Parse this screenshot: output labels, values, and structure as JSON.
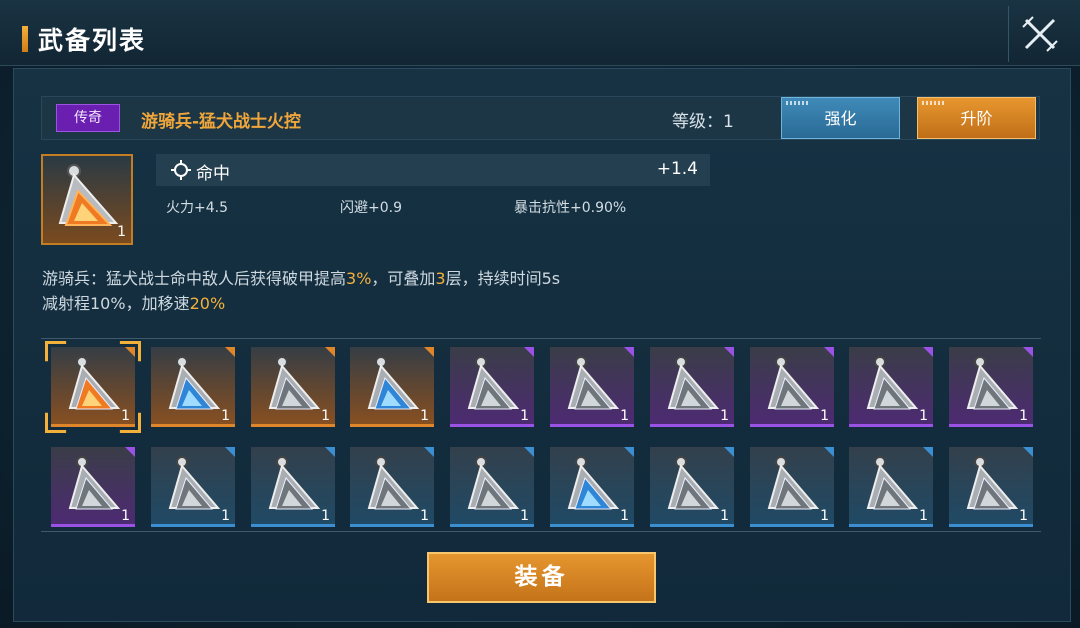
{
  "header": {
    "title": "武备列表",
    "close_icon": "close-icon"
  },
  "item": {
    "rarity": "传奇",
    "name": "游骑兵-猛犬战士火控",
    "level_label": "等级：1",
    "quantity": "1",
    "main_stat": {
      "icon": "crosshair-icon",
      "label": "命中",
      "value": "+1.4"
    },
    "sub_stats": [
      "火力+4.5",
      "闪避+0.9",
      "暴击抗性+0.90%"
    ],
    "description": {
      "line1_parts": [
        "游骑兵：猛犬战士命中敌人后获得破甲提高",
        "3%",
        "，可叠加",
        "3",
        "层，持续时间5s"
      ],
      "line2_parts": [
        "减射程10%，加移速",
        "20%"
      ]
    }
  },
  "buttons": {
    "enhance": "强化",
    "advance": "升阶",
    "equip": "装备"
  },
  "inventory": {
    "rows": [
      [
        {
          "rarity": "orange",
          "variant": "orange",
          "qty": "1",
          "selected": true
        },
        {
          "rarity": "orange",
          "variant": "blue",
          "qty": "1"
        },
        {
          "rarity": "orange",
          "variant": "silver",
          "qty": "1"
        },
        {
          "rarity": "orange",
          "variant": "blue",
          "qty": "1"
        },
        {
          "rarity": "purple",
          "variant": "silver",
          "qty": "1"
        },
        {
          "rarity": "purple",
          "variant": "silver",
          "qty": "1"
        },
        {
          "rarity": "purple",
          "variant": "silver",
          "qty": "1"
        },
        {
          "rarity": "purple",
          "variant": "silver",
          "qty": "1"
        },
        {
          "rarity": "purple",
          "variant": "silver",
          "qty": "1"
        },
        {
          "rarity": "purple",
          "variant": "silver",
          "qty": "1"
        }
      ],
      [
        {
          "rarity": "purple",
          "variant": "silver",
          "qty": "1"
        },
        {
          "rarity": "blue",
          "variant": "silver",
          "qty": "1"
        },
        {
          "rarity": "blue",
          "variant": "silver",
          "qty": "1"
        },
        {
          "rarity": "blue",
          "variant": "silver",
          "qty": "1"
        },
        {
          "rarity": "blue",
          "variant": "silver",
          "qty": "1"
        },
        {
          "rarity": "blue",
          "variant": "blue",
          "qty": "1"
        },
        {
          "rarity": "blue",
          "variant": "silver",
          "qty": "1"
        },
        {
          "rarity": "blue",
          "variant": "silver",
          "qty": "1"
        },
        {
          "rarity": "blue",
          "variant": "silver",
          "qty": "1"
        },
        {
          "rarity": "blue",
          "variant": "silver",
          "qty": "1"
        }
      ]
    ]
  },
  "colors": {
    "accent_gold": "#f3b13c",
    "rarity_legendary": "#6a1fb0",
    "enhance_blue": "#3f8ab8",
    "advance_orange": "#e7962f"
  }
}
